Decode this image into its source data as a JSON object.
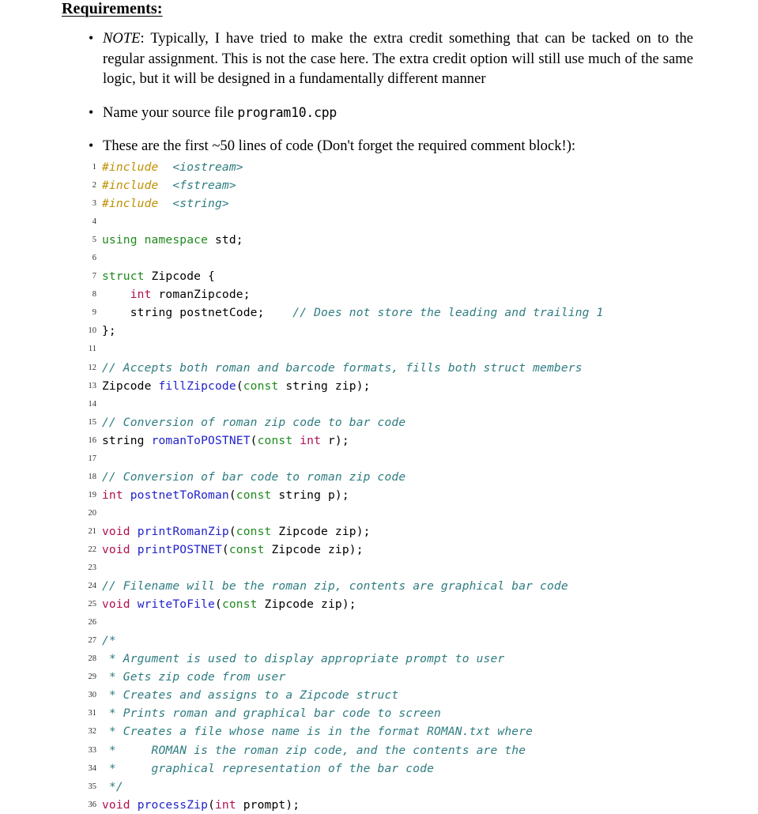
{
  "heading": "Requirements:",
  "bullets": [
    {
      "id": "note-bullet",
      "marker": "•",
      "lead_italic": "NOTE",
      "text": ": Typically, I have tried to make the extra credit something that can be tacked on to the regular assignment. This is not the case here. The extra credit option will still use much of the same logic, but it will be designed in a fundamentally different manner"
    },
    {
      "id": "filename-bullet",
      "marker": "•",
      "text_before": "Name your source file ",
      "mono": "program10.cpp",
      "text_after": ""
    },
    {
      "id": "code-intro-bullet",
      "marker": "•",
      "text": "These are the first ~50 lines of code (Don't forget the required comment block!):"
    }
  ],
  "colors": {
    "preprocessor": "#BF9000",
    "header": "#2E7C80",
    "comment": "#2E7C80",
    "keyword": "#1E8A1E",
    "type": "#B01050",
    "function": "#2222CC",
    "plain": "#000000",
    "line_number": "#303030",
    "background": "#FFFFFF"
  },
  "listing": {
    "language": "C++",
    "first_line_number": 1,
    "last_line_number": 36,
    "lines": [
      {
        "n": 1,
        "tokens": [
          {
            "t": "#include",
            "c": "pre"
          },
          {
            "t": "  ",
            "c": "plain"
          },
          {
            "t": "<iostream>",
            "c": "header"
          }
        ]
      },
      {
        "n": 2,
        "tokens": [
          {
            "t": "#include",
            "c": "pre"
          },
          {
            "t": "  ",
            "c": "plain"
          },
          {
            "t": "<fstream>",
            "c": "header"
          }
        ]
      },
      {
        "n": 3,
        "tokens": [
          {
            "t": "#include",
            "c": "pre"
          },
          {
            "t": "  ",
            "c": "plain"
          },
          {
            "t": "<string>",
            "c": "header"
          }
        ]
      },
      {
        "n": 4,
        "tokens": []
      },
      {
        "n": 5,
        "tokens": [
          {
            "t": "using namespace",
            "c": "keyword"
          },
          {
            "t": " std;",
            "c": "plain"
          }
        ]
      },
      {
        "n": 6,
        "tokens": []
      },
      {
        "n": 7,
        "tokens": [
          {
            "t": "struct",
            "c": "keyword"
          },
          {
            "t": " Zipcode {",
            "c": "plain"
          }
        ]
      },
      {
        "n": 8,
        "tokens": [
          {
            "t": "    ",
            "c": "plain"
          },
          {
            "t": "int",
            "c": "type"
          },
          {
            "t": " romanZipcode;",
            "c": "plain"
          }
        ]
      },
      {
        "n": 9,
        "tokens": [
          {
            "t": "    string postnetCode;    ",
            "c": "plain"
          },
          {
            "t": "// Does not store the leading and trailing 1",
            "c": "comment"
          }
        ]
      },
      {
        "n": 10,
        "tokens": [
          {
            "t": "};",
            "c": "plain"
          }
        ]
      },
      {
        "n": 11,
        "tokens": []
      },
      {
        "n": 12,
        "tokens": [
          {
            "t": "// Accepts both roman and barcode formats, fills both struct members",
            "c": "comment"
          }
        ]
      },
      {
        "n": 13,
        "tokens": [
          {
            "t": "Zipcode ",
            "c": "plain"
          },
          {
            "t": "fillZipcode",
            "c": "func"
          },
          {
            "t": "(",
            "c": "plain"
          },
          {
            "t": "const",
            "c": "keyword"
          },
          {
            "t": " string zip);",
            "c": "plain"
          }
        ]
      },
      {
        "n": 14,
        "tokens": []
      },
      {
        "n": 15,
        "tokens": [
          {
            "t": "// Conversion of roman zip code to bar code",
            "c": "comment"
          }
        ]
      },
      {
        "n": 16,
        "tokens": [
          {
            "t": "string ",
            "c": "plain"
          },
          {
            "t": "romanToPOSTNET",
            "c": "func"
          },
          {
            "t": "(",
            "c": "plain"
          },
          {
            "t": "const",
            "c": "keyword"
          },
          {
            "t": " ",
            "c": "plain"
          },
          {
            "t": "int",
            "c": "type"
          },
          {
            "t": " r);",
            "c": "plain"
          }
        ]
      },
      {
        "n": 17,
        "tokens": []
      },
      {
        "n": 18,
        "tokens": [
          {
            "t": "// Conversion of bar code to roman zip code",
            "c": "comment"
          }
        ]
      },
      {
        "n": 19,
        "tokens": [
          {
            "t": "int",
            "c": "type"
          },
          {
            "t": " ",
            "c": "plain"
          },
          {
            "t": "postnetToRoman",
            "c": "func"
          },
          {
            "t": "(",
            "c": "plain"
          },
          {
            "t": "const",
            "c": "keyword"
          },
          {
            "t": " string p);",
            "c": "plain"
          }
        ]
      },
      {
        "n": 20,
        "tokens": []
      },
      {
        "n": 21,
        "tokens": [
          {
            "t": "void",
            "c": "type"
          },
          {
            "t": " ",
            "c": "plain"
          },
          {
            "t": "printRomanZip",
            "c": "func"
          },
          {
            "t": "(",
            "c": "plain"
          },
          {
            "t": "const",
            "c": "keyword"
          },
          {
            "t": " Zipcode zip);",
            "c": "plain"
          }
        ]
      },
      {
        "n": 22,
        "tokens": [
          {
            "t": "void",
            "c": "type"
          },
          {
            "t": " ",
            "c": "plain"
          },
          {
            "t": "printPOSTNET",
            "c": "func"
          },
          {
            "t": "(",
            "c": "plain"
          },
          {
            "t": "const",
            "c": "keyword"
          },
          {
            "t": " Zipcode zip);",
            "c": "plain"
          }
        ]
      },
      {
        "n": 23,
        "tokens": []
      },
      {
        "n": 24,
        "tokens": [
          {
            "t": "// Filename will be the roman zip, contents are graphical bar code",
            "c": "comment"
          }
        ]
      },
      {
        "n": 25,
        "tokens": [
          {
            "t": "void",
            "c": "type"
          },
          {
            "t": " ",
            "c": "plain"
          },
          {
            "t": "writeToFile",
            "c": "func"
          },
          {
            "t": "(",
            "c": "plain"
          },
          {
            "t": "const",
            "c": "keyword"
          },
          {
            "t": " Zipcode zip);",
            "c": "plain"
          }
        ]
      },
      {
        "n": 26,
        "tokens": []
      },
      {
        "n": 27,
        "tokens": [
          {
            "t": "/*",
            "c": "comment"
          }
        ]
      },
      {
        "n": 28,
        "tokens": [
          {
            "t": " * Argument is used to display appropriate prompt to user",
            "c": "comment"
          }
        ]
      },
      {
        "n": 29,
        "tokens": [
          {
            "t": " * Gets zip code from user",
            "c": "comment"
          }
        ]
      },
      {
        "n": 30,
        "tokens": [
          {
            "t": " * Creates and assigns to a Zipcode struct",
            "c": "comment"
          }
        ]
      },
      {
        "n": 31,
        "tokens": [
          {
            "t": " * Prints roman and graphical bar code to screen",
            "c": "comment"
          }
        ]
      },
      {
        "n": 32,
        "tokens": [
          {
            "t": " * Creates a file whose name is in the format ROMAN.txt where",
            "c": "comment"
          }
        ]
      },
      {
        "n": 33,
        "tokens": [
          {
            "t": " *     ROMAN is the roman zip code, and the contents are the",
            "c": "comment"
          }
        ]
      },
      {
        "n": 34,
        "tokens": [
          {
            "t": " *     graphical representation of the bar code",
            "c": "comment"
          }
        ]
      },
      {
        "n": 35,
        "tokens": [
          {
            "t": " */",
            "c": "comment"
          }
        ]
      },
      {
        "n": 36,
        "tokens": [
          {
            "t": "void",
            "c": "type"
          },
          {
            "t": " ",
            "c": "plain"
          },
          {
            "t": "processZip",
            "c": "func"
          },
          {
            "t": "(",
            "c": "plain"
          },
          {
            "t": "int",
            "c": "type"
          },
          {
            "t": " prompt);",
            "c": "plain"
          }
        ]
      }
    ]
  }
}
